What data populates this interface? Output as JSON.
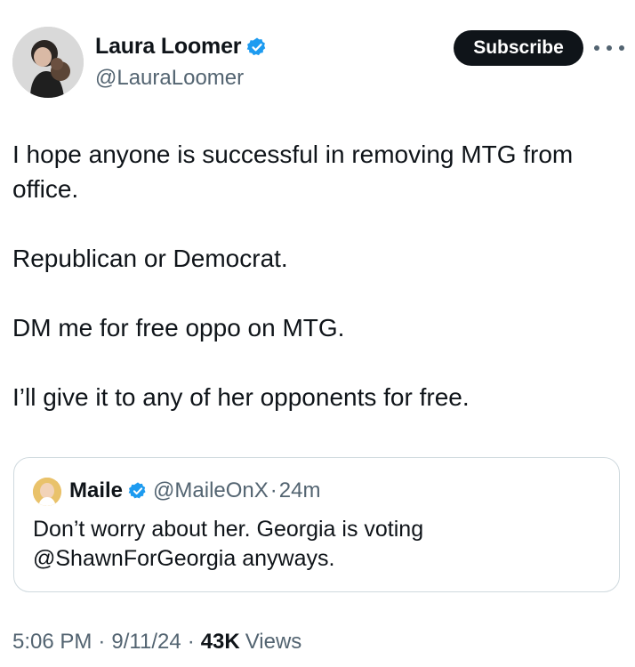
{
  "author": {
    "display_name": "Laura Loomer",
    "handle": "@LauraLoomer",
    "verified_icon": "verified-badge-icon"
  },
  "actions": {
    "subscribe_label": "Subscribe",
    "more_icon": "more-horizontal-icon"
  },
  "tweet": {
    "paragraphs": [
      "I hope anyone is successful in removing MTG from office.",
      "Republican or Democrat.",
      "DM me for free oppo on MTG.",
      "I’ll give it to any of her opponents for free."
    ]
  },
  "quote": {
    "display_name": "Maile",
    "handle": "@MaileOnX",
    "separator": "·",
    "time": "24m",
    "text_line1": "Don’t worry about her. Georgia is voting",
    "text_line2": "@ShawnForGeorgia anyways."
  },
  "meta": {
    "time": "5:06 PM",
    "date": "9/11/24",
    "separator": "·",
    "views_count": "43K",
    "views_label": "Views"
  },
  "colors": {
    "verified_blue": "#1d9bf0",
    "text_primary": "#0f1419",
    "text_secondary": "#536471",
    "border": "#cfd9de"
  }
}
